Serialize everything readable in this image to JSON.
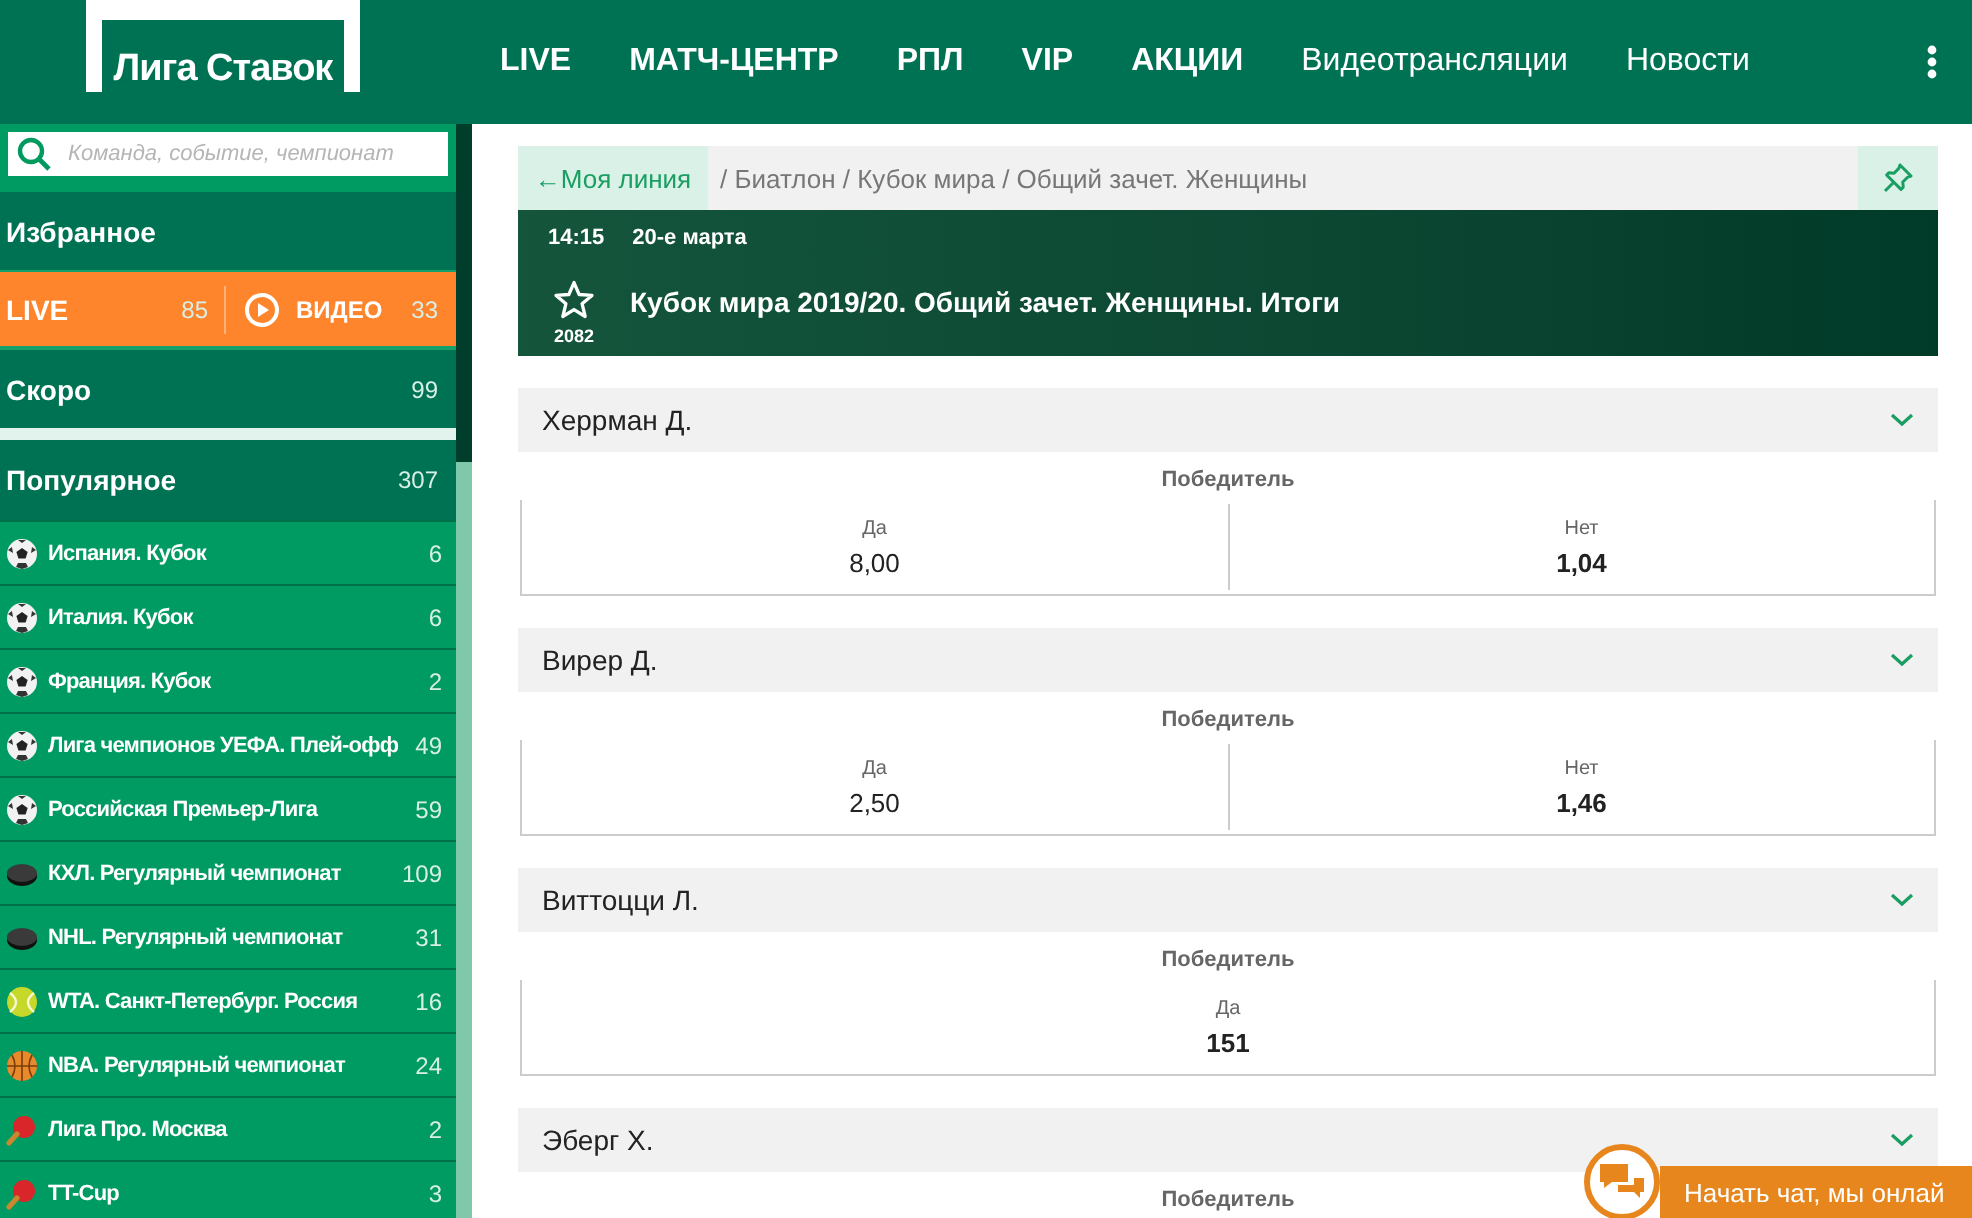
{
  "header": {
    "logo": "Лига Ставок",
    "nav": [
      {
        "label": "LIVE",
        "kind": "promo"
      },
      {
        "label": "МАТЧ-ЦЕНТР",
        "kind": "promo"
      },
      {
        "label": "РПЛ",
        "kind": "promo"
      },
      {
        "label": "VIP",
        "kind": "promo"
      },
      {
        "label": "АКЦИИ",
        "kind": "promo"
      },
      {
        "label": "Видеотрансляции",
        "kind": "link"
      },
      {
        "label": "Новости",
        "kind": "link"
      }
    ]
  },
  "sidebar": {
    "search": {
      "placeholder": "Команда, событие, чемпионат"
    },
    "favorites": {
      "label": "Избранное"
    },
    "live": {
      "label": "LIVE",
      "count": "85",
      "video_label": "ВИДЕО",
      "video_count": "33"
    },
    "soon": {
      "label": "Скоро",
      "count": "99"
    },
    "popular": {
      "label": "Популярное",
      "count": "307"
    },
    "items": [
      {
        "kind": "football",
        "label": "Испания. Кубок",
        "count": "6"
      },
      {
        "kind": "football",
        "label": "Италия. Кубок",
        "count": "6"
      },
      {
        "kind": "football",
        "label": "Франция. Кубок",
        "count": "2"
      },
      {
        "kind": "football",
        "label": "Лига чемпионов УЕФА. Плей-офф",
        "count": "49"
      },
      {
        "kind": "football",
        "label": "Российская Премьер-Лига",
        "count": "59"
      },
      {
        "kind": "hockey",
        "label": "КХЛ. Регулярный чемпионат",
        "count": "109"
      },
      {
        "kind": "hockey",
        "label": "NHL. Регулярный чемпионат",
        "count": "31"
      },
      {
        "kind": "tennis",
        "label": "WTA. Санкт-Петербург. Россия",
        "count": "16"
      },
      {
        "kind": "basketball",
        "label": "NBA. Регулярный чемпионат",
        "count": "24"
      },
      {
        "kind": "table-tennis",
        "label": "Лига Про. Москва",
        "count": "2"
      },
      {
        "kind": "table-tennis",
        "label": "TT-Cup",
        "count": "3"
      }
    ]
  },
  "breadcrumb": {
    "back": "←Моя линия",
    "path": "/ Биатлон / Кубок мира / Общий зачет. Женщины"
  },
  "event": {
    "time": "14:15",
    "date": "20-е марта",
    "title": "Кубок мира 2019/20. Общий зачет. Женщины. Итоги",
    "favorite": false,
    "favorites_count": "2082"
  },
  "markets": [
    {
      "participant": "Херрман Д.",
      "market": "Победитель",
      "outcomes": [
        {
          "label": "Да",
          "odd": "8,00",
          "highlight": false
        },
        {
          "label": "Нет",
          "odd": "1,04",
          "highlight": true
        }
      ]
    },
    {
      "participant": "Вирер Д.",
      "market": "Победитель",
      "outcomes": [
        {
          "label": "Да",
          "odd": "2,50",
          "highlight": false
        },
        {
          "label": "Нет",
          "odd": "1,46",
          "highlight": true
        }
      ]
    },
    {
      "participant": "Виттоцци Л.",
      "market": "Победитель",
      "outcomes": [
        {
          "label": "Да",
          "odd": "151",
          "highlight": true
        }
      ]
    },
    {
      "participant": "Эберг Х.",
      "market": "Победитель"
    }
  ],
  "chat": {
    "label": "Начать чат, мы онлай"
  }
}
